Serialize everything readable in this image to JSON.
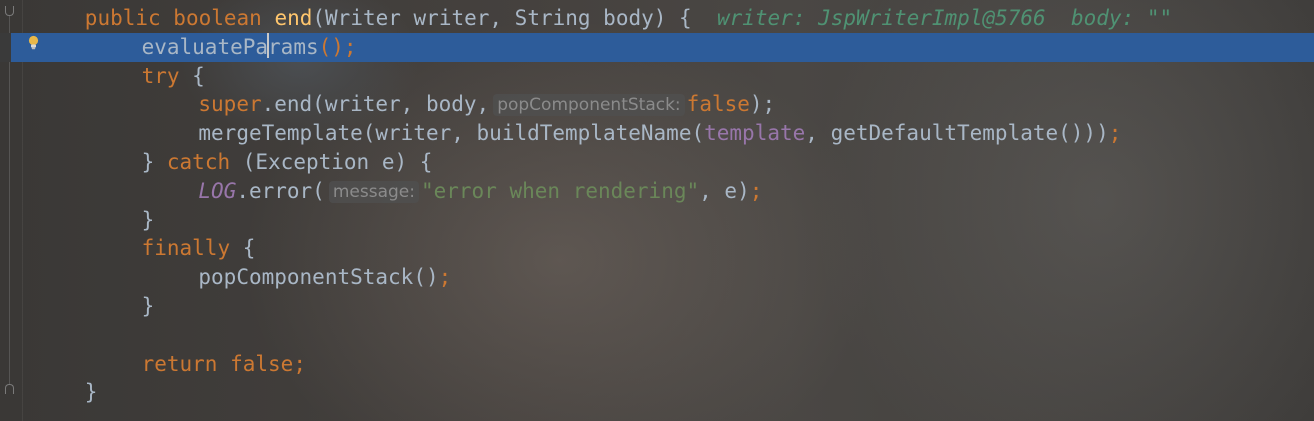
{
  "editor": {
    "lines": [
      {
        "indent": "  ",
        "tokens": [
          {
            "t": "public boolean ",
            "k": "kw"
          },
          {
            "t": "end",
            "k": "fn"
          },
          {
            "t": "(Writer writer, String body) {  ",
            "k": ""
          },
          {
            "t": "writer: JspWriterImpl@5766  body: \"\"",
            "k": "dbg"
          }
        ]
      },
      {
        "indent": "    ",
        "highlighted": true,
        "tokens": [
          {
            "t": "evaluatePa",
            "k": ""
          },
          {
            "t": "",
            "k": "caret"
          },
          {
            "t": "rams",
            "k": ""
          },
          {
            "t": "();",
            "k": "kw"
          }
        ]
      },
      {
        "indent": "    ",
        "tokens": [
          {
            "t": "try",
            "k": "kw"
          },
          {
            "t": " {",
            "k": ""
          }
        ]
      },
      {
        "indent": "      ",
        "tokens": [
          {
            "t": "super",
            "k": "kw"
          },
          {
            "t": ".end(writer, body,",
            "k": ""
          },
          {
            "t": "popComponentStack:",
            "k": "hint"
          },
          {
            "t": "false",
            "k": "kw"
          },
          {
            "t": ");",
            "k": ""
          }
        ]
      },
      {
        "indent": "      ",
        "tokens": [
          {
            "t": "mergeTemplate(writer, buildTemplateName(",
            "k": ""
          },
          {
            "t": "template",
            "k": "field"
          },
          {
            "t": ", getDefaultTemplate()))",
            "k": ""
          },
          {
            "t": ";",
            "k": "kw"
          }
        ]
      },
      {
        "indent": "    ",
        "tokens": [
          {
            "t": "} ",
            "k": ""
          },
          {
            "t": "catch",
            "k": "kw"
          },
          {
            "t": " (Exception e) {",
            "k": ""
          }
        ]
      },
      {
        "indent": "      ",
        "tokens": [
          {
            "t": "LOG",
            "k": "field-i"
          },
          {
            "t": ".error(",
            "k": ""
          },
          {
            "t": "message:",
            "k": "hint"
          },
          {
            "t": "\"error when rendering\"",
            "k": "str"
          },
          {
            "t": ", e)",
            "k": ""
          },
          {
            "t": ";",
            "k": "kw"
          }
        ]
      },
      {
        "indent": "    ",
        "tokens": [
          {
            "t": "}",
            "k": ""
          }
        ]
      },
      {
        "indent": "    ",
        "tokens": [
          {
            "t": "finally",
            "k": "kw"
          },
          {
            "t": " {",
            "k": ""
          }
        ]
      },
      {
        "indent": "      ",
        "tokens": [
          {
            "t": "popComponentStack()",
            "k": ""
          },
          {
            "t": ";",
            "k": "kw"
          }
        ]
      },
      {
        "indent": "    ",
        "tokens": [
          {
            "t": "}",
            "k": ""
          }
        ]
      },
      {
        "indent": "",
        "tokens": []
      },
      {
        "indent": "    ",
        "tokens": [
          {
            "t": "return false",
            "k": "kw"
          },
          {
            "t": ";",
            "k": "kw"
          }
        ]
      },
      {
        "indent": "  ",
        "tokens": [
          {
            "t": "}",
            "k": ""
          }
        ]
      }
    ]
  },
  "colors": {
    "keyword": "#cc7832",
    "method_decl": "#ffc66d",
    "field": "#9876aa",
    "string": "#6a8759",
    "debug_value": "#4f9273",
    "current_line": "#2d5c9a"
  },
  "gutter": {
    "intention_icon": "lightbulb-icon"
  }
}
